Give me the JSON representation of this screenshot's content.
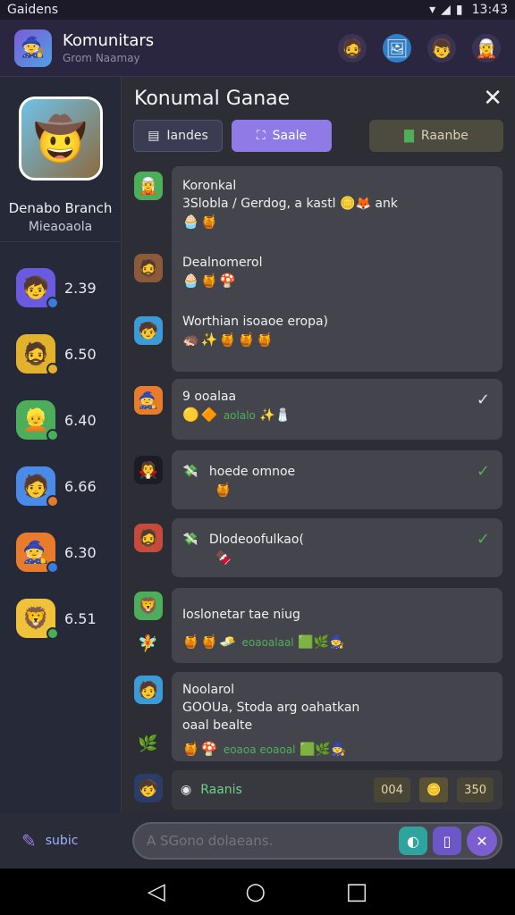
{
  "status_bar": {
    "carrier": "Gaidens",
    "clock": "13:43"
  },
  "header": {
    "app_title": "Komunitars",
    "app_subtitle": "Grom Naamay",
    "icons": [
      "player-icon",
      "gallery-icon",
      "friend-icon",
      "friend2-icon"
    ]
  },
  "sidebar": {
    "profile_name": "Denabo Branch",
    "profile_sub": "Mieaoaola",
    "items": [
      {
        "count": "2.39",
        "color": "#6a5ae0",
        "dot": "#3b7ddd"
      },
      {
        "count": "6.50",
        "color": "#e3b22c",
        "dot": "#e3b22c"
      },
      {
        "count": "6.40",
        "color": "#4cae5a",
        "dot": "#4cae5a"
      },
      {
        "count": "6.66",
        "color": "#4a8ae8",
        "dot": "#e37b2c"
      },
      {
        "count": "6.30",
        "color": "#e87b2c",
        "dot": "#3b7ddd"
      },
      {
        "count": "6.51",
        "color": "#f0c23a",
        "dot": "#4cae5a"
      }
    ]
  },
  "panel": {
    "title": "Konumal Ganae",
    "close_label": "✕",
    "tabs": [
      {
        "label": "Iandes"
      },
      {
        "label": "Saale"
      },
      {
        "label": "Raanbe"
      }
    ]
  },
  "messages": [
    {
      "line1": "Koronkal",
      "line2": "3Slobla / Gerdog, a kastl",
      "line2b": "ank",
      "emojis": "🧁🍯"
    },
    {
      "line1": "Dealnomerol",
      "emojis": "🧁🍯🍄"
    },
    {
      "line1": "Worthian isoaoe eropa)",
      "emojis": "🦔✨🍯🍯🍯"
    },
    {
      "line1": "9 ooalaa",
      "emojis": "🟡🔶",
      "green": "aolalo",
      "check": "✓"
    },
    {
      "line1": "hoede omnoe",
      "emojis": "🍯",
      "check": "✓"
    },
    {
      "line1": "Dlodeoofulkao(",
      "emojis": "🍫",
      "check": "✓"
    },
    {
      "line1": "Ioslonetar tae niug",
      "emojis": "🍯🍯🧈",
      "green": "eoaoalaal"
    },
    {
      "line1": "Noolarol",
      "line2": "GOOUa, Stoda arg oahatkan",
      "line3": "oaal bealte",
      "emojis": "🍯🍄",
      "green": "eoaoa eoaoal"
    }
  ],
  "footer": {
    "label": "Raanis",
    "chip1": "004",
    "chip2": "350"
  },
  "composer": {
    "action_label": "subic",
    "placeholder": "A SGono dolaeans."
  }
}
